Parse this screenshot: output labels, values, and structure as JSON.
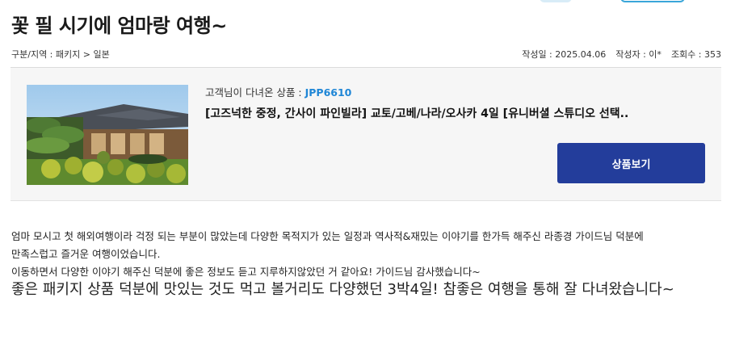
{
  "post": {
    "title": "꽃 필 시기에 엄마랑 여행~",
    "category": "구분/지역 : 패키지 > 일본",
    "date": "작성일 : 2025.04.06",
    "author": "작성자 : 이*",
    "views": "조회수 : 353"
  },
  "product": {
    "code_label": "고객님이 다녀온 상품 : ",
    "code": "JPP6610",
    "name": "[고즈넉한 중정, 간사이 파인빌라] 교토/고베/나라/오사카 4일 [유니버셜 스튜디오 선택..",
    "view_button": "상품보기",
    "image_icon": "japanese-garden-photo"
  },
  "review": {
    "lines": [
      "엄마 모시고 첫 해외여행이라 걱정 되는 부분이 많았는데 다양한 목적지가 있는 일정과 역사적&재밌는 이야기를 한가득 해주신 라종경 가이드님 덕분에",
      "만족스럽고 즐거운 여행이었습니다.",
      "이동하면서 다양한 이야기 해주신 덕분에 좋은 정보도 듣고 지루하지않았던 거 같아요! 가이드님 감사했습니다~"
    ],
    "highlight": "좋은 패키지 상품 덕분에 맛있는 것도 먹고 볼거리도 다양했던 3박4일! 참좋은 여행을 통해 잘 다녀왔습니다~"
  },
  "colors": {
    "accent": "#233d9b",
    "code_blue": "#1f86d6",
    "box_bg": "#f6f6f6"
  }
}
